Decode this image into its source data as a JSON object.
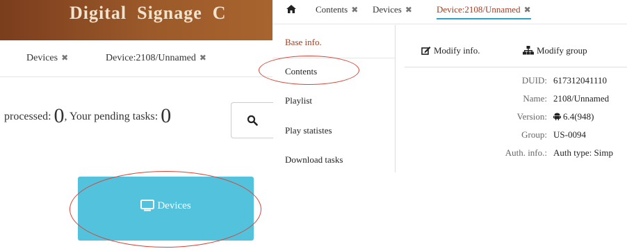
{
  "banner": {
    "title": "Digital  Signage  C"
  },
  "left_tabs": [
    {
      "label": "Devices"
    },
    {
      "label": "Device:2108/Unnamed"
    }
  ],
  "tasks": {
    "processed_label": "processed:",
    "processed_value": "0",
    "separator": ",",
    "pending_label": "Your pending tasks:",
    "pending_value": "0"
  },
  "devices_button": {
    "label": "Devices"
  },
  "right_tabs": [
    {
      "label": "Contents"
    },
    {
      "label": "Devices"
    },
    {
      "label": "Device:2108/Unnamed"
    }
  ],
  "menu": [
    {
      "label": "Base info."
    },
    {
      "label": "Contents"
    },
    {
      "label": "Playlist"
    },
    {
      "label": "Play statistes"
    },
    {
      "label": "Download tasks"
    }
  ],
  "actions": {
    "modify_info": "Modify info.",
    "modify_group": "Modify group"
  },
  "info": [
    {
      "label": "DUID:",
      "value": "617312041110"
    },
    {
      "label": "Name:",
      "value": "2108/Unnamed"
    },
    {
      "label": "Version:",
      "value": "6.4(948)"
    },
    {
      "label": "Group:",
      "value": "US-0094"
    },
    {
      "label": "Auth. info.:",
      "value": "Auth type: Simp"
    }
  ],
  "colors": {
    "accent": "#a23e23",
    "button": "#53c3dd",
    "annotation": "#d94335",
    "banner": "#8a4a22"
  }
}
